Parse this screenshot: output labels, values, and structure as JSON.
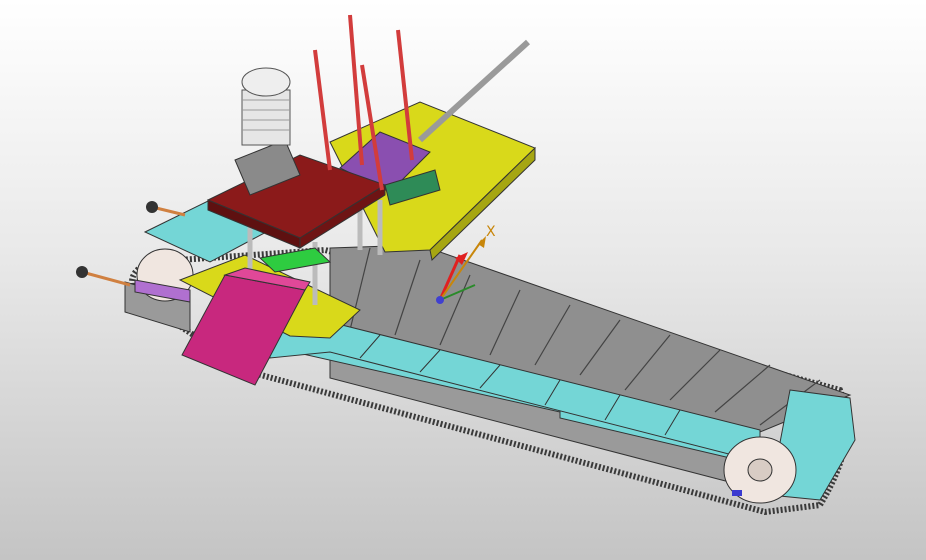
{
  "viewport": {
    "background_top": "#ffffff",
    "background_bottom": "#c4c4c4"
  },
  "triad": {
    "x_label": "X",
    "x_color": "#c8860a",
    "y_color": "#2a8a2a",
    "z_color": "#e02020"
  },
  "colors": {
    "belt_plate": "#8f8f8f",
    "belt_plate_top": "#a2a2a2",
    "frame_panel": "#74d6d6",
    "frame_panel_dark": "#4fb0b0",
    "chain": "#3a3a3a",
    "base_plate": "#d9d91a",
    "mount_plate": "#8b1a1a",
    "chute": "#c8287e",
    "motor": "#e6e6e6",
    "rods": "#d23c3c",
    "pulley": "#f0e6e0",
    "purple_block": "#8a4fb0",
    "green_block": "#2ecc40"
  },
  "icons": [
    "coordinate-triad-icon"
  ]
}
